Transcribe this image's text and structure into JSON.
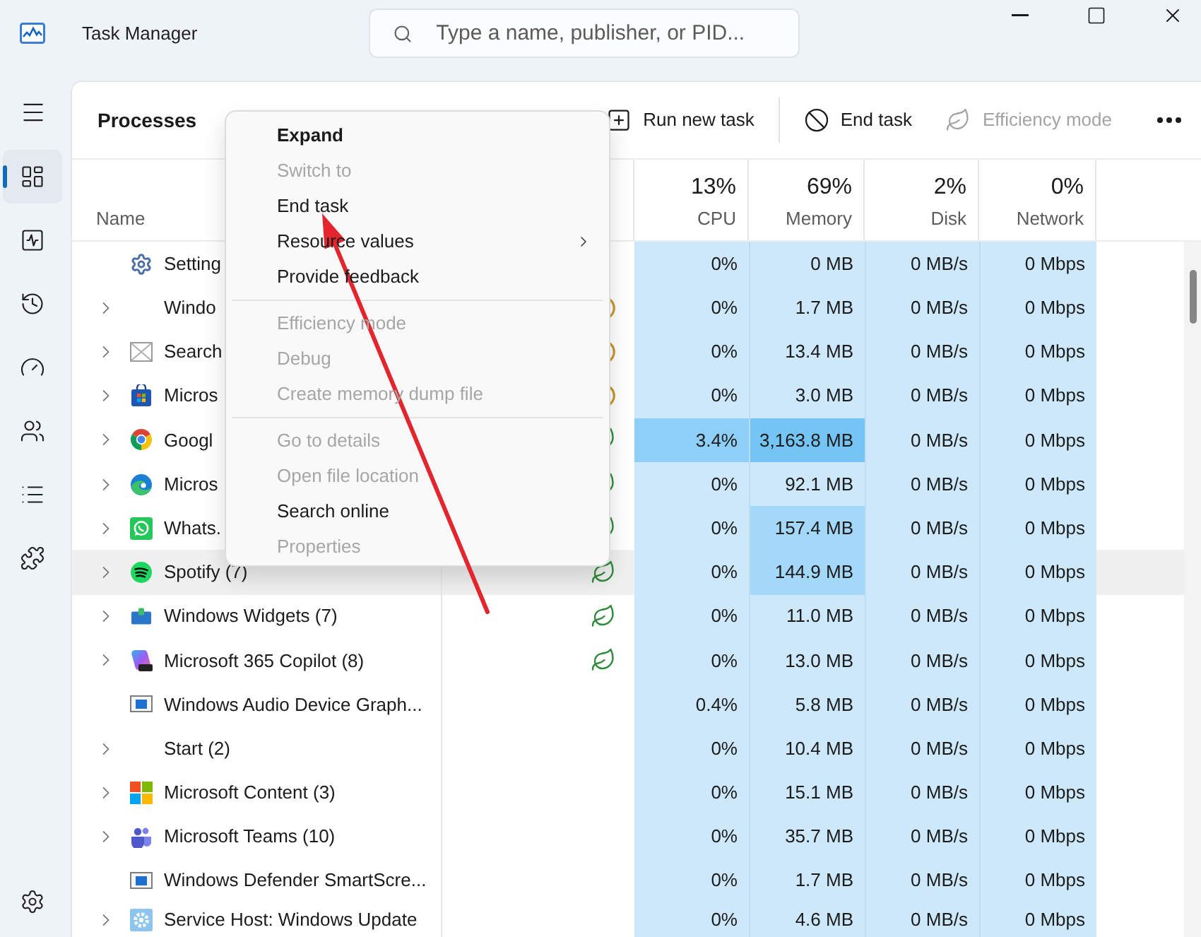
{
  "window": {
    "title": "Task Manager"
  },
  "search": {
    "placeholder": "Type a name, publisher, or PID..."
  },
  "sidebar": {
    "items": [
      {
        "selected": true
      },
      {
        "selected": false
      },
      {
        "selected": false
      },
      {
        "selected": false
      },
      {
        "selected": false
      },
      {
        "selected": false
      },
      {
        "selected": false
      }
    ]
  },
  "page": {
    "title": "Processes"
  },
  "toolbar": [
    {
      "kind": "button",
      "label": "Run new task",
      "disabled": false
    },
    {
      "kind": "separator"
    },
    {
      "kind": "button",
      "label": "End task",
      "disabled": false
    },
    {
      "kind": "button",
      "label": "Efficiency mode",
      "disabled": true
    }
  ],
  "table": {
    "name_header": "Name",
    "metric_columns": [
      {
        "total": "13%",
        "label": "CPU"
      },
      {
        "total": "69%",
        "label": "Memory"
      },
      {
        "total": "2%",
        "label": "Disk"
      },
      {
        "total": "0%",
        "label": "Network"
      }
    ],
    "rows": [
      {
        "name": "Setting",
        "expandable": false,
        "selected": false,
        "suspended": false,
        "efficiency_mode": false,
        "cells": [
          {
            "text": "0%",
            "color": "#cce8fa"
          },
          {
            "text": "0 MB",
            "color": "#cce8fa"
          },
          {
            "text": "0 MB/s",
            "color": "#cce8fa"
          },
          {
            "text": "0 Mbps",
            "color": "#cce8fa"
          }
        ]
      },
      {
        "name": "Windo",
        "expandable": true,
        "selected": false,
        "suspended": true,
        "efficiency_mode": false,
        "cells": [
          {
            "text": "0%",
            "color": "#cce8fa"
          },
          {
            "text": "1.7 MB",
            "color": "#cce8fa"
          },
          {
            "text": "0 MB/s",
            "color": "#cce8fa"
          },
          {
            "text": "0 Mbps",
            "color": "#cce8fa"
          }
        ]
      },
      {
        "name": "Search",
        "expandable": true,
        "selected": false,
        "suspended": true,
        "efficiency_mode": false,
        "cells": [
          {
            "text": "0%",
            "color": "#cce8fa"
          },
          {
            "text": "13.4 MB",
            "color": "#cce8fa"
          },
          {
            "text": "0 MB/s",
            "color": "#cce8fa"
          },
          {
            "text": "0 Mbps",
            "color": "#cce8fa"
          }
        ]
      },
      {
        "name": "Micros",
        "expandable": true,
        "selected": false,
        "suspended": true,
        "efficiency_mode": false,
        "cells": [
          {
            "text": "0%",
            "color": "#cce8fa"
          },
          {
            "text": "3.0 MB",
            "color": "#cce8fa"
          },
          {
            "text": "0 MB/s",
            "color": "#cce8fa"
          },
          {
            "text": "0 Mbps",
            "color": "#cce8fa"
          }
        ]
      },
      {
        "name": "Googl",
        "expandable": true,
        "selected": false,
        "suspended": false,
        "efficiency_mode": true,
        "cells": [
          {
            "text": "3.4%",
            "color": "#8dcff7"
          },
          {
            "text": "3,163.8 MB",
            "color": "#74c4f4"
          },
          {
            "text": "0 MB/s",
            "color": "#cce8fa"
          },
          {
            "text": "0 Mbps",
            "color": "#cce8fa"
          }
        ]
      },
      {
        "name": "Micros",
        "expandable": true,
        "selected": false,
        "suspended": false,
        "efficiency_mode": true,
        "cells": [
          {
            "text": "0%",
            "color": "#cce8fa"
          },
          {
            "text": "92.1 MB",
            "color": "#cce8fa"
          },
          {
            "text": "0 MB/s",
            "color": "#cce8fa"
          },
          {
            "text": "0 Mbps",
            "color": "#cce8fa"
          }
        ]
      },
      {
        "name": "Whats.",
        "expandable": true,
        "selected": false,
        "suspended": false,
        "efficiency_mode": true,
        "cells": [
          {
            "text": "0%",
            "color": "#cce8fa"
          },
          {
            "text": "157.4 MB",
            "color": "#a4d8f9"
          },
          {
            "text": "0 MB/s",
            "color": "#cce8fa"
          },
          {
            "text": "0 Mbps",
            "color": "#cce8fa"
          }
        ]
      },
      {
        "name": "Spotify (7)",
        "expandable": true,
        "selected": true,
        "suspended": false,
        "efficiency_mode": true,
        "cells": [
          {
            "text": "0%",
            "color": "#cce8fa"
          },
          {
            "text": "144.9 MB",
            "color": "#a4d8f9"
          },
          {
            "text": "0 MB/s",
            "color": "#cce8fa"
          },
          {
            "text": "0 Mbps",
            "color": "#cce8fa"
          }
        ]
      },
      {
        "name": "Windows Widgets (7)",
        "expandable": true,
        "selected": false,
        "suspended": false,
        "efficiency_mode": true,
        "cells": [
          {
            "text": "0%",
            "color": "#cce8fa"
          },
          {
            "text": "11.0 MB",
            "color": "#cce8fa"
          },
          {
            "text": "0 MB/s",
            "color": "#cce8fa"
          },
          {
            "text": "0 Mbps",
            "color": "#cce8fa"
          }
        ]
      },
      {
        "name": "Microsoft 365 Copilot (8)",
        "expandable": true,
        "selected": false,
        "suspended": false,
        "efficiency_mode": true,
        "cells": [
          {
            "text": "0%",
            "color": "#cce8fa"
          },
          {
            "text": "13.0 MB",
            "color": "#cce8fa"
          },
          {
            "text": "0 MB/s",
            "color": "#cce8fa"
          },
          {
            "text": "0 Mbps",
            "color": "#cce8fa"
          }
        ]
      },
      {
        "name": "Windows Audio Device Graph...",
        "expandable": false,
        "selected": false,
        "suspended": false,
        "efficiency_mode": false,
        "cells": [
          {
            "text": "0.4%",
            "color": "#cce8fa"
          },
          {
            "text": "5.8 MB",
            "color": "#cce8fa"
          },
          {
            "text": "0 MB/s",
            "color": "#cce8fa"
          },
          {
            "text": "0 Mbps",
            "color": "#cce8fa"
          }
        ]
      },
      {
        "name": "Start (2)",
        "expandable": true,
        "selected": false,
        "suspended": false,
        "efficiency_mode": false,
        "cells": [
          {
            "text": "0%",
            "color": "#cce8fa"
          },
          {
            "text": "10.4 MB",
            "color": "#cce8fa"
          },
          {
            "text": "0 MB/s",
            "color": "#cce8fa"
          },
          {
            "text": "0 Mbps",
            "color": "#cce8fa"
          }
        ]
      },
      {
        "name": "Microsoft Content (3)",
        "expandable": true,
        "selected": false,
        "suspended": false,
        "efficiency_mode": false,
        "cells": [
          {
            "text": "0%",
            "color": "#cce8fa"
          },
          {
            "text": "15.1 MB",
            "color": "#cce8fa"
          },
          {
            "text": "0 MB/s",
            "color": "#cce8fa"
          },
          {
            "text": "0 Mbps",
            "color": "#cce8fa"
          }
        ]
      },
      {
        "name": "Microsoft Teams (10)",
        "expandable": true,
        "selected": false,
        "suspended": false,
        "efficiency_mode": false,
        "cells": [
          {
            "text": "0%",
            "color": "#cce8fa"
          },
          {
            "text": "35.7 MB",
            "color": "#cce8fa"
          },
          {
            "text": "0 MB/s",
            "color": "#cce8fa"
          },
          {
            "text": "0 Mbps",
            "color": "#cce8fa"
          }
        ]
      },
      {
        "name": "Windows Defender SmartScre...",
        "expandable": false,
        "selected": false,
        "suspended": false,
        "efficiency_mode": false,
        "cells": [
          {
            "text": "0%",
            "color": "#cce8fa"
          },
          {
            "text": "1.7 MB",
            "color": "#cce8fa"
          },
          {
            "text": "0 MB/s",
            "color": "#cce8fa"
          },
          {
            "text": "0 Mbps",
            "color": "#cce8fa"
          }
        ]
      },
      {
        "name": "Service Host: Windows Update",
        "expandable": true,
        "selected": false,
        "suspended": false,
        "efficiency_mode": false,
        "cells": [
          {
            "text": "0%",
            "color": "#cce8fa"
          },
          {
            "text": "4.6 MB",
            "color": "#cce8fa"
          },
          {
            "text": "0 MB/s",
            "color": "#cce8fa"
          },
          {
            "text": "0 Mbps",
            "color": "#cce8fa"
          }
        ]
      }
    ]
  },
  "context_menu": {
    "items": [
      {
        "kind": "item",
        "label": "Expand",
        "default": true,
        "disabled": false
      },
      {
        "kind": "item",
        "label": "Switch to",
        "default": false,
        "disabled": true
      },
      {
        "kind": "item",
        "label": "End task",
        "default": false,
        "disabled": false
      },
      {
        "kind": "submenu",
        "label": "Resource values",
        "default": false,
        "disabled": false
      },
      {
        "kind": "item",
        "label": "Provide feedback",
        "default": false,
        "disabled": false
      },
      {
        "kind": "separator"
      },
      {
        "kind": "item",
        "label": "Efficiency mode",
        "default": false,
        "disabled": true
      },
      {
        "kind": "item",
        "label": "Debug",
        "default": false,
        "disabled": true
      },
      {
        "kind": "item",
        "label": "Create memory dump file",
        "default": false,
        "disabled": true
      },
      {
        "kind": "separator"
      },
      {
        "kind": "item",
        "label": "Go to details",
        "default": false,
        "disabled": true
      },
      {
        "kind": "item",
        "label": "Open file location",
        "default": false,
        "disabled": true
      },
      {
        "kind": "item",
        "label": "Search online",
        "default": false,
        "disabled": false
      },
      {
        "kind": "item",
        "label": "Properties",
        "default": false,
        "disabled": true
      }
    ]
  }
}
